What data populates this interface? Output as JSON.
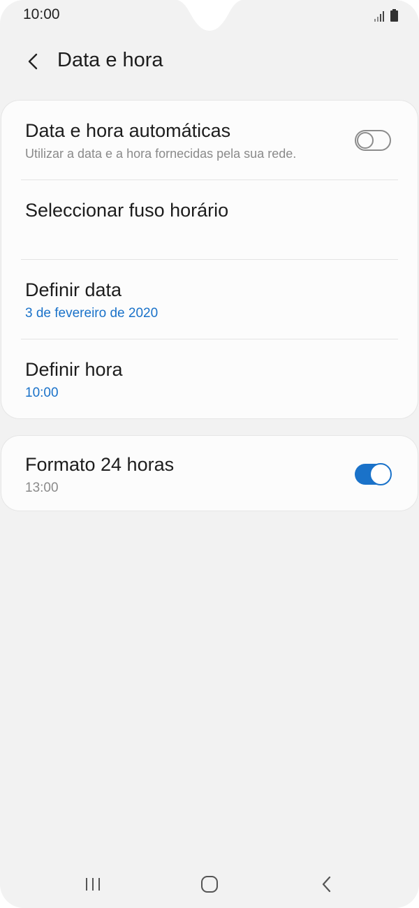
{
  "status_bar": {
    "time": "10:00",
    "icons": [
      "signal-icon",
      "battery-icon"
    ]
  },
  "header": {
    "back_icon": "chevron-left-icon",
    "title": "Data e hora"
  },
  "settings": {
    "auto_datetime": {
      "title": "Data e hora automáticas",
      "subtitle": "Utilizar a data e a hora fornecidas pela sua rede.",
      "enabled": false
    },
    "timezone": {
      "title": "Seleccionar fuso horário"
    },
    "set_date": {
      "title": "Definir data",
      "value": "3 de fevereiro de 2020"
    },
    "set_time": {
      "title": "Definir hora",
      "value": "10:00"
    },
    "format_24h": {
      "title": "Formato 24 horas",
      "value": "13:00",
      "enabled": true
    }
  },
  "nav_bar": {
    "icons": [
      "recents-icon",
      "home-icon",
      "back-icon"
    ]
  },
  "colors": {
    "accent": "#1a72c9",
    "background": "#f2f2f2",
    "card": "#fcfcfc",
    "text_primary": "#1d1d1d",
    "text_secondary": "#8a8a8a"
  }
}
